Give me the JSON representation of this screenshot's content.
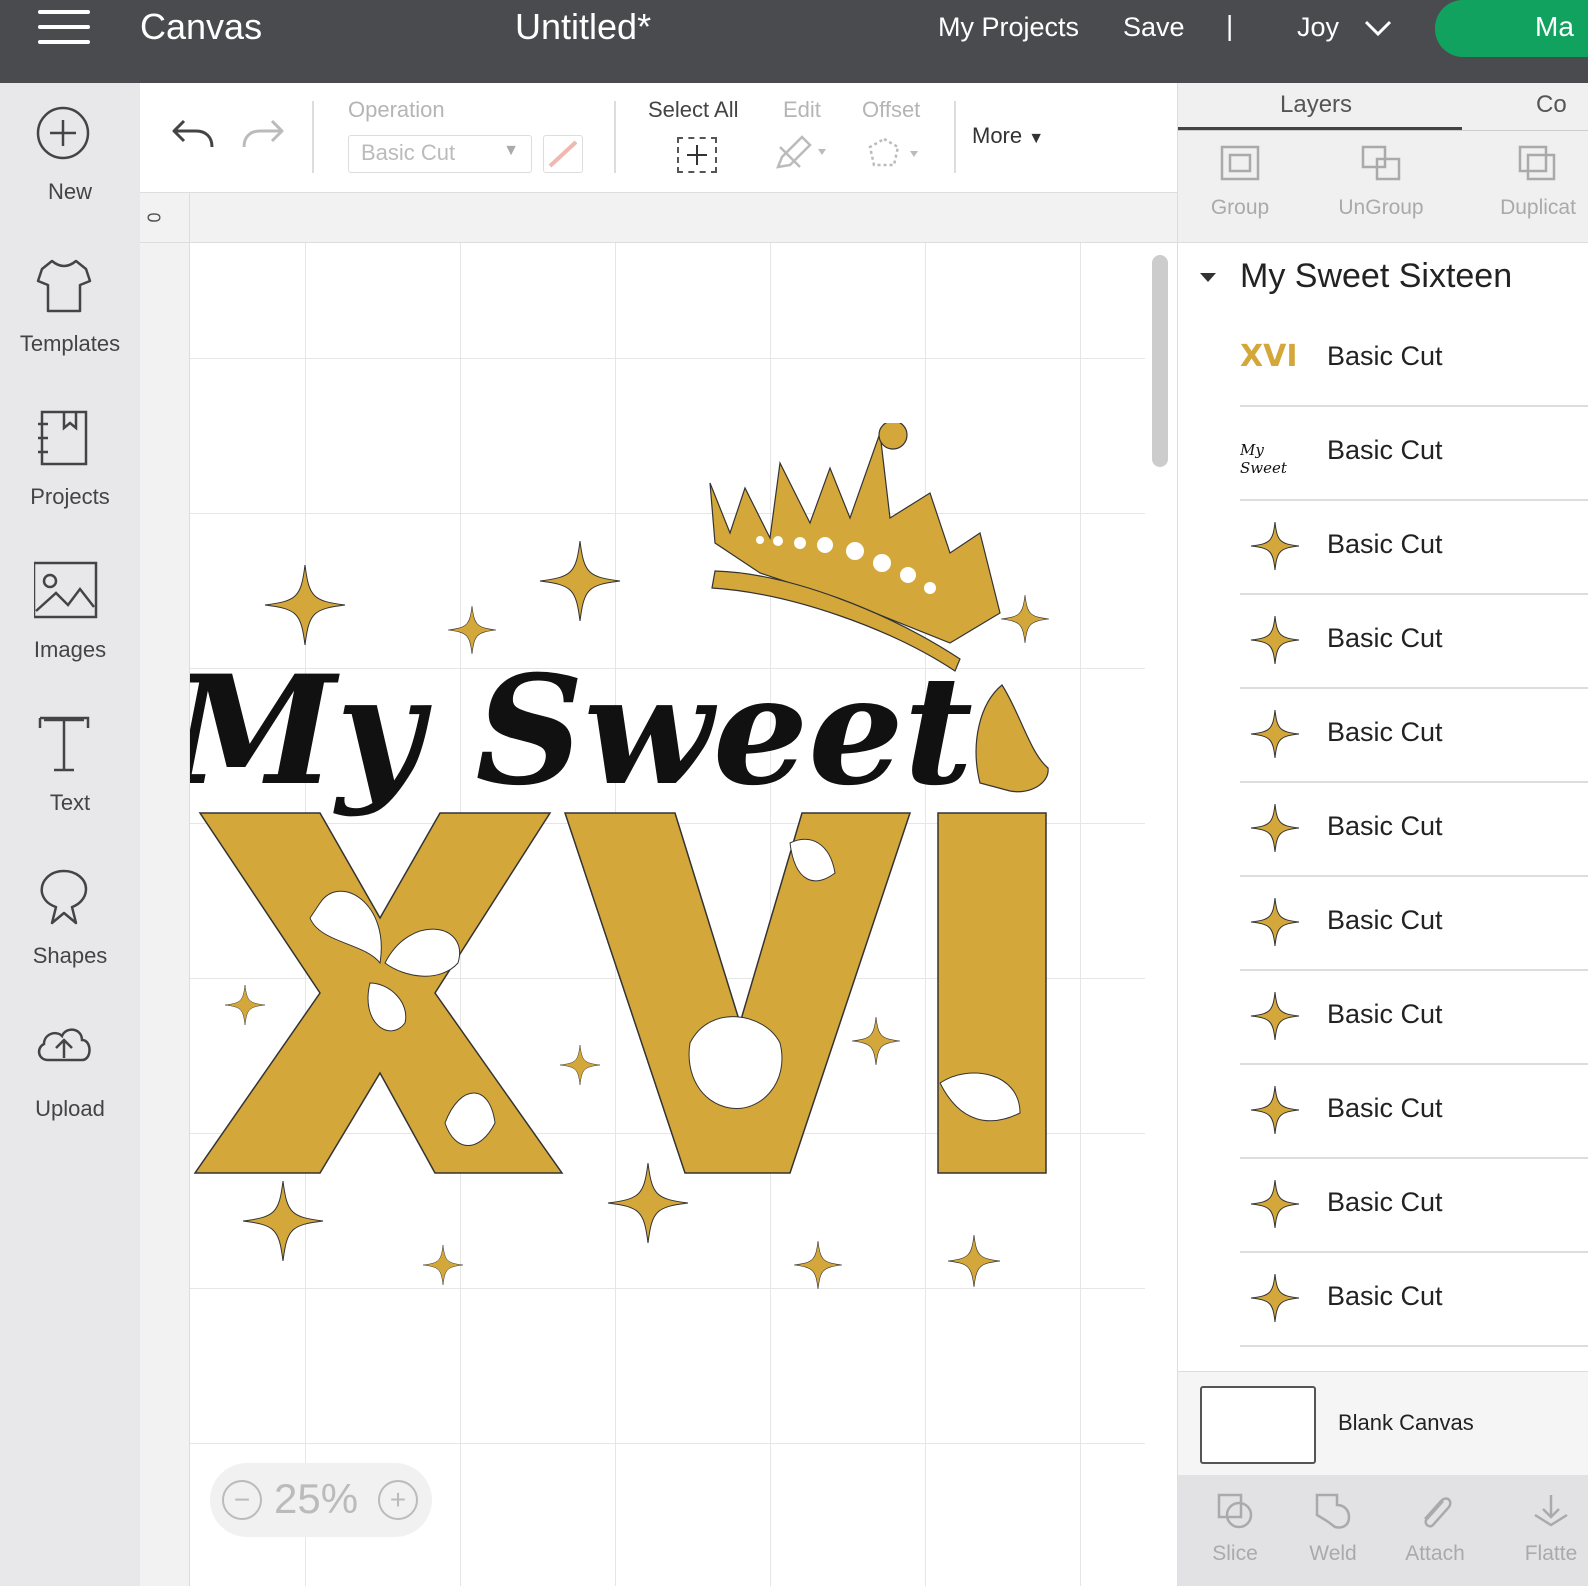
{
  "topbar": {
    "app_title": "Canvas",
    "doc_title": "Untitled*",
    "my_projects": "My Projects",
    "save": "Save",
    "separator": "|",
    "user": "Joy",
    "make_label": "Ma"
  },
  "sidebar": {
    "items": [
      {
        "label": "New",
        "icon": "plus-circle-icon"
      },
      {
        "label": "Templates",
        "icon": "tshirt-icon"
      },
      {
        "label": "Projects",
        "icon": "notebook-icon"
      },
      {
        "label": "Images",
        "icon": "image-icon"
      },
      {
        "label": "Text",
        "icon": "text-icon"
      },
      {
        "label": "Shapes",
        "icon": "shapes-icon"
      },
      {
        "label": "Upload",
        "icon": "cloud-upload-icon"
      }
    ]
  },
  "toolbar": {
    "operation_label": "Operation",
    "operation_value": "Basic Cut",
    "select_all": "Select All",
    "edit": "Edit",
    "offset": "Offset",
    "more": "More"
  },
  "canvas": {
    "ruler_zero": "0",
    "zoom": "25%",
    "design_text": "My Sweet",
    "design_letters": "XVI",
    "accent_color": "#d4a73b"
  },
  "right_panel": {
    "tabs": [
      "Layers",
      "Co"
    ],
    "tools": [
      "Group",
      "UnGroup",
      "Duplicat"
    ],
    "group_title": "My Sweet Sixteen",
    "layers": [
      {
        "name": "Basic Cut",
        "thumb": "xvi"
      },
      {
        "name": "Basic Cut",
        "thumb": "my-sweet"
      },
      {
        "name": "Basic Cut",
        "thumb": "star"
      },
      {
        "name": "Basic Cut",
        "thumb": "star"
      },
      {
        "name": "Basic Cut",
        "thumb": "star"
      },
      {
        "name": "Basic Cut",
        "thumb": "star"
      },
      {
        "name": "Basic Cut",
        "thumb": "star"
      },
      {
        "name": "Basic Cut",
        "thumb": "star"
      },
      {
        "name": "Basic Cut",
        "thumb": "star"
      },
      {
        "name": "Basic Cut",
        "thumb": "star"
      },
      {
        "name": "Basic Cut",
        "thumb": "star"
      }
    ],
    "layer_thumb_text": {
      "xvi": "XVI",
      "my_sweet": "My Sweet"
    },
    "blank_canvas": "Blank Canvas",
    "bottom_tools": [
      "Slice",
      "Weld",
      "Attach",
      "Flatte"
    ]
  }
}
